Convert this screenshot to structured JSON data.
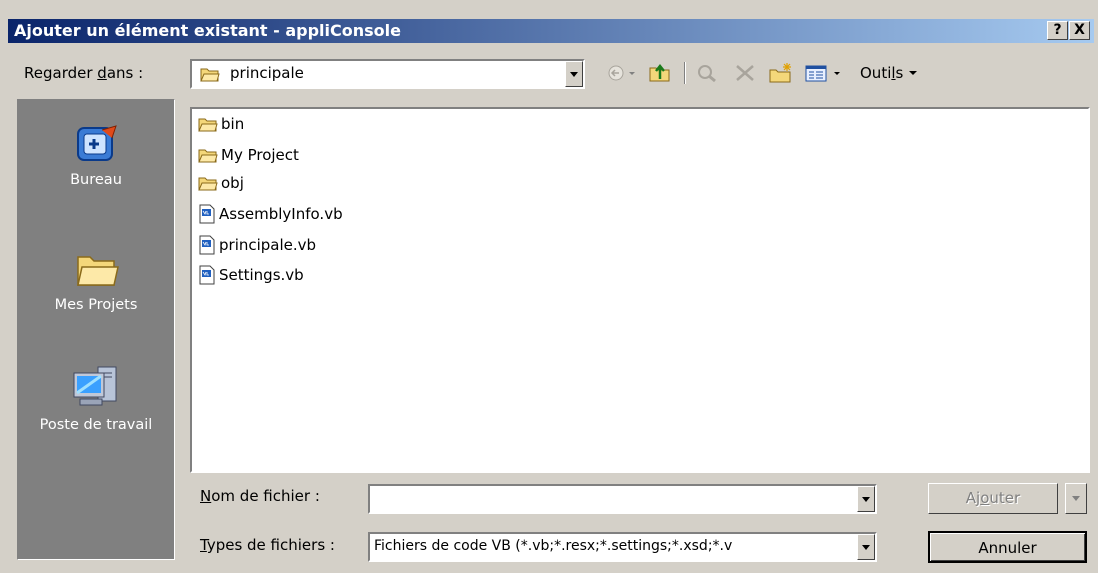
{
  "window": {
    "title": "Ajouter un élément existant - appliConsole",
    "help_label": "?",
    "close_label": "X"
  },
  "lookin": {
    "label_pre": "Regarder ",
    "label_accel": "d",
    "label_post": "ans :",
    "value": "principale"
  },
  "toolbar": {
    "tools_pre": "Outi",
    "tools_accel": "l",
    "tools_post": "s",
    "items": [
      "back-icon",
      "up-folder-icon",
      "search-web-icon",
      "delete-icon",
      "new-folder-icon",
      "views-icon"
    ]
  },
  "places": [
    {
      "label": "Bureau",
      "icon": "desktop-icon"
    },
    {
      "label": "Mes Projets",
      "icon": "folder-icon"
    },
    {
      "label": "Poste de travail",
      "icon": "computer-icon"
    }
  ],
  "files": [
    {
      "name": "bin",
      "type": "folder"
    },
    {
      "name": "My Project",
      "type": "folder"
    },
    {
      "name": "obj",
      "type": "folder"
    },
    {
      "name": "AssemblyInfo.vb",
      "type": "vb"
    },
    {
      "name": "principale.vb",
      "type": "vb"
    },
    {
      "name": "Settings.vb",
      "type": "vb"
    }
  ],
  "filename": {
    "label_accel": "N",
    "label_post": "om de fichier :",
    "value": ""
  },
  "filetype": {
    "label_accel": "T",
    "label_post": "ypes de fichiers :",
    "value": "Fichiers de code VB (*.vb;*.resx;*.settings;*.xsd;*.v"
  },
  "buttons": {
    "add_pre": "Aj",
    "add_accel": "o",
    "add_post": "uter",
    "cancel": "Annuler"
  },
  "colors": {
    "title_start": "#0a246a",
    "title_end": "#a6caf0",
    "face": "#d4d0c8",
    "places_bg": "#808080"
  }
}
